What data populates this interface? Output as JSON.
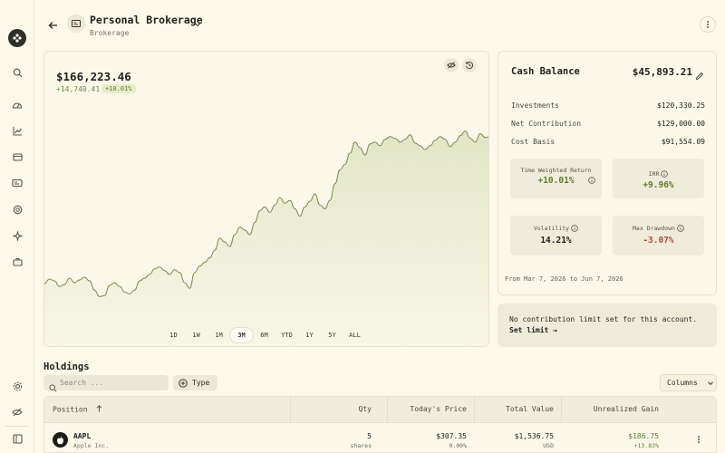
{
  "header": {
    "account_name": "Personal Brokerage",
    "account_type": "Brokerage"
  },
  "chart": {
    "value": "$166,223.46",
    "change": "+14,740.41",
    "change_pct": "+10.01%",
    "periods": [
      "1D",
      "1W",
      "1M",
      "3M",
      "6M",
      "YTD",
      "1Y",
      "5Y",
      "ALL"
    ],
    "active_period": "3M"
  },
  "chart_data": {
    "type": "area",
    "title": "",
    "xlabel": "",
    "ylabel": "",
    "color": "#7a8a4e",
    "fill_color": "#dfe4c2",
    "x_range": [
      "Mar 7, 2026",
      "Jun 7, 2026"
    ],
    "y_axis_hidden": true,
    "values": [
      150.3,
      150.8,
      150.6,
      150.0,
      150.2,
      150.9,
      150.4,
      150.7,
      151.0,
      150.6,
      149.6,
      148.9,
      149.0,
      150.1,
      150.4,
      150.0,
      149.4,
      149.2,
      149.6,
      150.6,
      150.9,
      151.3,
      151.9,
      152.1,
      151.7,
      151.3,
      151.8,
      151.5,
      150.4,
      149.8,
      151.5,
      152.2,
      152.6,
      153.1,
      153.9,
      155.2,
      154.8,
      154.3,
      155.6,
      156.4,
      156.1,
      155.6,
      156.9,
      158.2,
      158.6,
      158.0,
      158.8,
      159.6,
      159.0,
      159.3,
      158.4,
      157.6,
      158.6,
      159.2,
      160.0,
      158.8,
      158.4,
      159.3,
      161.1,
      162.6,
      163.2,
      164.4,
      165.6,
      165.0,
      164.2,
      165.4,
      165.6,
      165.2,
      165.9,
      166.2,
      166.0,
      165.6,
      165.9,
      166.4,
      165.5,
      165.2,
      164.8,
      165.2,
      165.8,
      166.2,
      165.9,
      165.1,
      165.6,
      166.3,
      166.8,
      166.0,
      165.6,
      166.5,
      166.1,
      166.2
    ],
    "ylim": [
      146.0,
      169.5
    ]
  },
  "summary": {
    "cash_label": "Cash Balance",
    "cash_value": "$45,893.21",
    "rows": [
      {
        "label": "Investments",
        "value": "$120,330.25"
      },
      {
        "label": "Net Contribution",
        "value": "$129,000.00"
      },
      {
        "label": "Cost Basis",
        "value": "$91,554.09"
      }
    ],
    "metrics": [
      {
        "label": "Time Weighted Return",
        "value": "+10.01%",
        "status": "positive"
      },
      {
        "label": "IRR",
        "value": "+9.96%",
        "status": "positive"
      },
      {
        "label": "Volatility",
        "value": "14.21%",
        "status": "neutral"
      },
      {
        "label": "Max Drawdown",
        "value": "-3.07%",
        "status": "negative"
      }
    ],
    "date_range": "From Mar 7, 2026 to Jun 7, 2026"
  },
  "limit": {
    "message": "No contribution limit set for this account.",
    "link": "Set limit →"
  },
  "holdings": {
    "title": "Holdings",
    "search_placeholder": "Search ...",
    "type_label": "Type",
    "columns_label": "Columns",
    "headers": {
      "position": "Position",
      "qty": "Qty",
      "price": "Today's Price",
      "total": "Total Value",
      "gain": "Unrealized Gain"
    },
    "rows": [
      {
        "ticker": "AAPL",
        "name": "Apple Inc.",
        "qty": "5",
        "qty_unit": "shares",
        "price": "$307.35",
        "price_change": "0.00%",
        "total": "$1,536.75",
        "currency": "USD",
        "gain": "$186.75",
        "gain_pct": "+13.83%"
      }
    ]
  },
  "colors": {
    "background": "#fcf9ea",
    "positive": "#5d7b2e",
    "negative": "#b04a3a",
    "accent_dark": "#2f2f2a"
  }
}
